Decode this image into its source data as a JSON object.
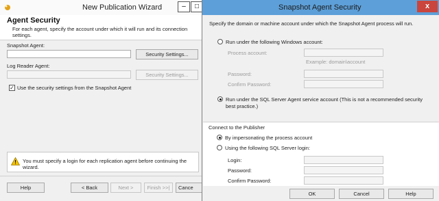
{
  "wizard": {
    "title": "New Publication Wizard",
    "minimize_glyph": "–",
    "maximize_glyph": "□",
    "page_heading": "Agent Security",
    "page_description": "For each agent, specify the account under which it will run and its connection settings.",
    "snapshot_agent_label": "Snapshot Agent:",
    "snapshot_agent_value": "",
    "security_settings_label": "Security Settings...",
    "log_reader_label": "Log Reader Agent:",
    "log_reader_value": "",
    "use_same_label": "Use the security settings from the Snapshot Agent",
    "use_same_checked": true,
    "warning_text": "You must specify a login for each replication agent before continuing the wizard.",
    "buttons": {
      "help": "Help",
      "back": "< Back",
      "next": "Next >",
      "finish": "Finish >>|",
      "cancel": "Cance"
    }
  },
  "dialog": {
    "title": "Snapshot Agent Security",
    "close_glyph": "x",
    "intro": "Specify the domain or machine account under which the Snapshot Agent process will run.",
    "run_windows_label": "Run under the following Windows account:",
    "process_account_label": "Process account:",
    "process_account_example": "Example: domain\\account",
    "password_label": "Password:",
    "confirm_password_label": "Confirm Password:",
    "run_sql_agent_label": "Run under the SQL Server Agent service account (This is not a recommended security best practice.)",
    "run_mode_selected": "sql_agent",
    "connect_heading": "Connect to the Publisher",
    "impersonate_label": "By impersonating the process account",
    "sql_login_label": "Using the following SQL Server login:",
    "connect_mode_selected": "impersonate",
    "login_label": "Login:",
    "login_password_label": "Password:",
    "login_confirm_label": "Confirm Password:",
    "buttons": {
      "ok": "OK",
      "cancel": "Cancel",
      "help": "Help"
    }
  },
  "icons": {
    "warning_color": "#f2c200",
    "wizard_icon_color": "#e3a21a",
    "title_bar_color": "#5d9fd8",
    "close_button_color": "#c9453e"
  }
}
